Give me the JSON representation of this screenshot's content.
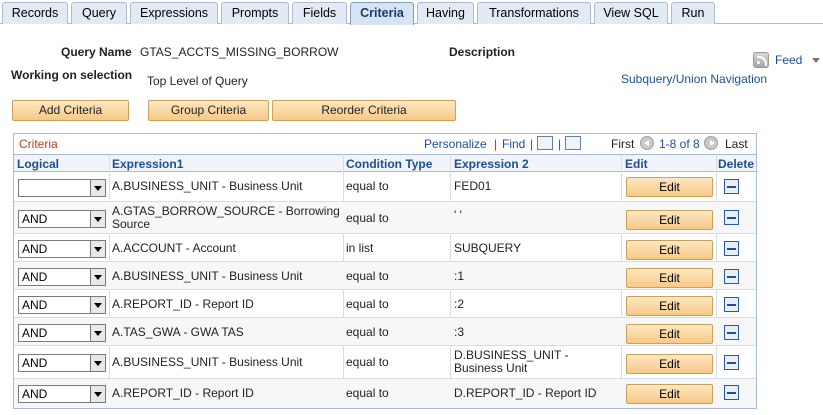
{
  "tabs": [
    {
      "label": "Records",
      "active": false
    },
    {
      "label": "Query",
      "active": false
    },
    {
      "label": "Expressions",
      "active": false
    },
    {
      "label": "Prompts",
      "active": false
    },
    {
      "label": "Fields",
      "active": false
    },
    {
      "label": "Criteria",
      "active": true
    },
    {
      "label": "Having",
      "active": false
    },
    {
      "label": "Transformations",
      "active": false
    },
    {
      "label": "View SQL",
      "active": false
    },
    {
      "label": "Run",
      "active": false
    }
  ],
  "query": {
    "name_label": "Query Name",
    "name_value": "GTAS_ACCTS_MISSING_BORROW",
    "description_label": "Description",
    "working_label": "Working on selection",
    "working_value": "Top Level of Query"
  },
  "feed_label": "Feed",
  "subquery_link": "Subquery/Union Navigation",
  "buttons": {
    "add": "Add Criteria",
    "group": "Group Criteria",
    "reorder": "Reorder Criteria"
  },
  "grid": {
    "title": "Criteria",
    "personalize": "Personalize",
    "separator": "|",
    "find": "Find",
    "first": "First",
    "range": "1-8 of 8",
    "last": "Last",
    "columns": [
      "Logical",
      "Expression1",
      "Condition Type",
      "Expression 2",
      "Edit",
      "Delete"
    ],
    "rows": [
      {
        "logical": "",
        "expr1": "A.BUSINESS_UNIT - Business Unit",
        "condition": "equal to",
        "expr2": "FED01",
        "edit": "Edit"
      },
      {
        "logical": "AND",
        "expr1": "A.GTAS_BORROW_SOURCE - Borrowing Source",
        "condition": "equal to",
        "expr2": "' '",
        "edit": "Edit"
      },
      {
        "logical": "AND",
        "expr1": "A.ACCOUNT - Account",
        "condition": "in list",
        "expr2": "SUBQUERY",
        "edit": "Edit"
      },
      {
        "logical": "AND",
        "expr1": "A.BUSINESS_UNIT - Business Unit",
        "condition": "equal to",
        "expr2": ":1",
        "edit": "Edit"
      },
      {
        "logical": "AND",
        "expr1": "A.REPORT_ID - Report ID",
        "condition": "equal to",
        "expr2": ":2",
        "edit": "Edit"
      },
      {
        "logical": "AND",
        "expr1": "A.TAS_GWA - GWA TAS",
        "condition": "equal to",
        "expr2": ":3",
        "edit": "Edit"
      },
      {
        "logical": "AND",
        "expr1": "A.BUSINESS_UNIT - Business Unit",
        "condition": "equal to",
        "expr2": "D.BUSINESS_UNIT - Business Unit",
        "edit": "Edit"
      },
      {
        "logical": "AND",
        "expr1": "A.REPORT_ID - Report ID",
        "condition": "equal to",
        "expr2": "D.REPORT_ID - Report ID",
        "edit": "Edit"
      }
    ]
  }
}
